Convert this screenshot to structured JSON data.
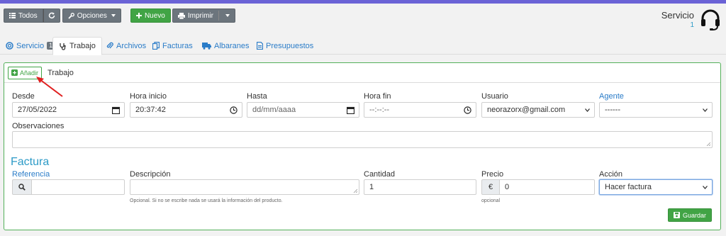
{
  "toolbar": {
    "todos": "Todos",
    "opciones": "Opciones",
    "nuevo": "Nuevo",
    "imprimir": "Imprimir"
  },
  "header": {
    "servicio_label": "Servicio",
    "servicio_number": "1"
  },
  "tabs": [
    {
      "label": "Servicio",
      "badge": "1"
    },
    {
      "label": "Trabajo"
    },
    {
      "label": "Archivos"
    },
    {
      "label": "Facturas"
    },
    {
      "label": "Albaranes"
    },
    {
      "label": "Presupuestos"
    }
  ],
  "panel": {
    "add_label": "Añadir",
    "title": "Trabajo"
  },
  "form": {
    "desde": {
      "label": "Desde",
      "value": "27/05/2022"
    },
    "hora_inicio": {
      "label": "Hora inicio",
      "value": "20:37:42"
    },
    "hasta": {
      "label": "Hasta",
      "placeholder": "dd/mm/aaaa"
    },
    "hora_fin": {
      "label": "Hora fin",
      "placeholder": "--:--:--"
    },
    "usuario": {
      "label": "Usuario",
      "value": "neorazorx@gmail.com"
    },
    "agente": {
      "label": "Agente",
      "value": "------"
    },
    "observaciones": {
      "label": "Observaciones",
      "value": ""
    }
  },
  "factura": {
    "heading": "Factura",
    "referencia": {
      "label": "Referencia",
      "value": ""
    },
    "descripcion": {
      "label": "Descripción",
      "value": "",
      "help": "Opcional. Si no se escribe nada se usará la información del producto."
    },
    "cantidad": {
      "label": "Cantidad",
      "value": "1"
    },
    "precio": {
      "label": "Precio",
      "currency": "€",
      "value": "0",
      "help": "opcional"
    },
    "accion": {
      "label": "Acción",
      "value": "Hacer factura"
    },
    "save_label": "Guardar"
  },
  "colors": {
    "accent_stripe": "#6b63d6",
    "success": "#41a445",
    "link": "#2a7cc8",
    "heading": "#2d9bc7",
    "annotation_arrow": "#e02020"
  },
  "icons": [
    "list-icon",
    "refresh-icon",
    "wrench-icon",
    "plus-icon",
    "print-icon",
    "headset-icon",
    "life-ring-icon",
    "stethoscope-icon",
    "paperclip-icon",
    "copy-icon",
    "truck-icon",
    "file-icon",
    "plus-square-icon",
    "calendar-icon",
    "clock-icon",
    "search-icon",
    "save-icon"
  ]
}
